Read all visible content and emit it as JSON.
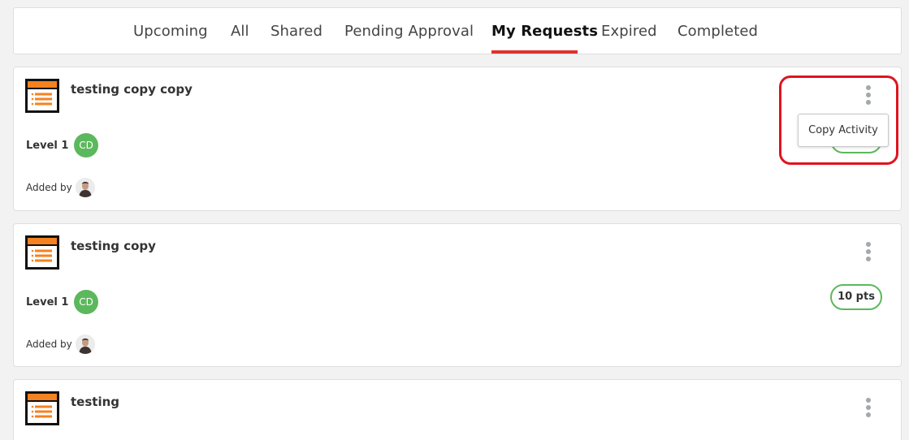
{
  "tabs": {
    "items": [
      {
        "label": "Upcoming"
      },
      {
        "label": "All"
      },
      {
        "label": "Shared"
      },
      {
        "label": "Pending Approval"
      },
      {
        "label": "My Requests"
      },
      {
        "label": "Expired"
      },
      {
        "label": "Completed"
      }
    ],
    "active": "My Requests"
  },
  "cards": [
    {
      "title": "testing copy copy",
      "level": "Level 1",
      "assignee_initials": "CD",
      "added_by_label": "Added by",
      "points": "10 pts",
      "menu_open": true
    },
    {
      "title": "testing copy",
      "level": "Level 1",
      "assignee_initials": "CD",
      "added_by_label": "Added by",
      "points": "10 pts",
      "menu_open": false
    },
    {
      "title": "testing"
    }
  ],
  "dropdown": {
    "copy_activity_label": "Copy Activity"
  },
  "colors": {
    "accent": "#e0312d",
    "highlight": "#e0141e",
    "badge_green": "#5cb85c",
    "icon_orange": "#f58220",
    "kebab_gray": "#a3a8ab"
  },
  "icons": [
    "activity-list-icon",
    "kebab-menu-icon",
    "user-avatar"
  ]
}
